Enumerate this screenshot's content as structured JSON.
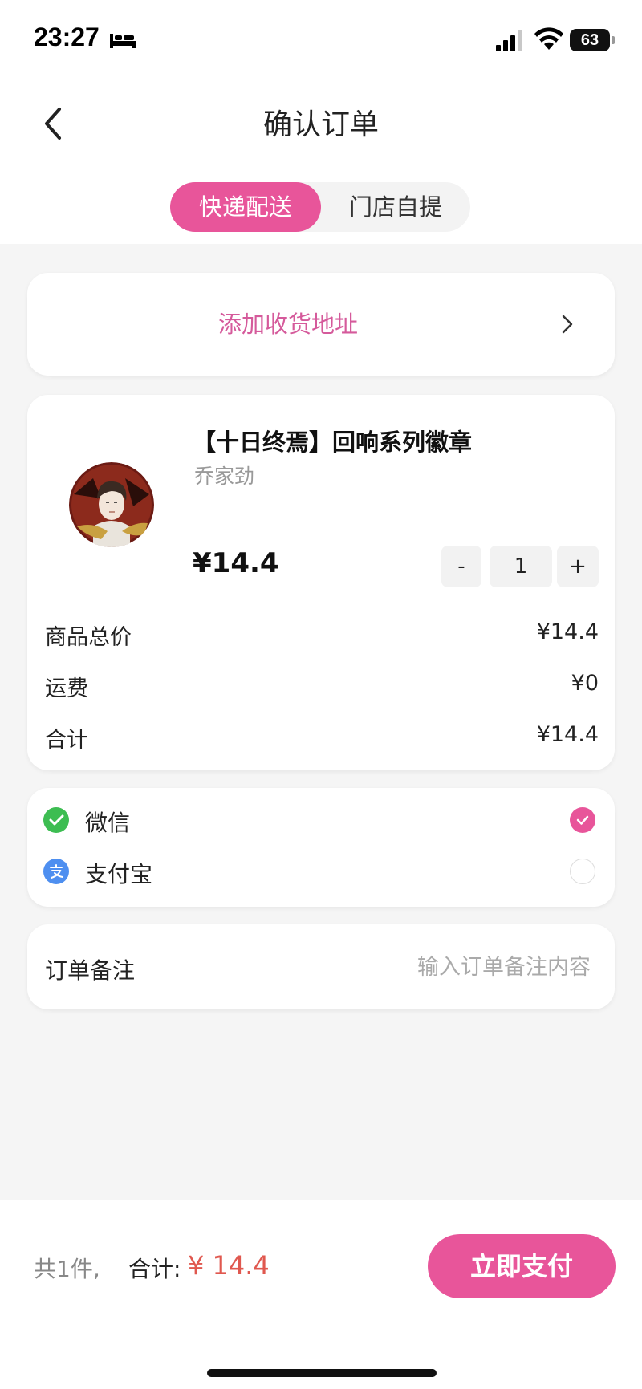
{
  "status_bar": {
    "time": "23:27",
    "battery": "63"
  },
  "nav": {
    "title": "确认订单"
  },
  "delivery_tabs": [
    {
      "label": "快递配送",
      "active": true
    },
    {
      "label": "门店自提",
      "active": false
    }
  ],
  "address": {
    "label": "添加收货地址"
  },
  "product": {
    "title": "【十日终焉】回响系列徽章",
    "subtitle": "乔家劲",
    "price": "¥14.4",
    "quantity": "1",
    "minus": "-",
    "plus": "+"
  },
  "summary": {
    "items_total_label": "商品总价",
    "items_total_value": "¥14.4",
    "shipping_label": "运费",
    "shipping_value": "¥0",
    "total_label": "合计",
    "total_value": "¥14.4"
  },
  "payment": {
    "options": [
      {
        "label": "微信",
        "icon": "wechat-icon",
        "selected": true
      },
      {
        "label": "支付宝",
        "icon": "alipay-icon",
        "selected": false
      }
    ]
  },
  "remark": {
    "label": "订单备注",
    "placeholder": "输入订单备注内容",
    "value": ""
  },
  "bottom": {
    "count": "共1件,",
    "total_label": "合计:",
    "total_value": "¥ 14.4",
    "pay_button": "立即支付"
  },
  "colors": {
    "accent": "#e8559a",
    "price_red": "#e0584f",
    "wechat_green": "#3dbd52",
    "alipay_blue": "#4e8ff0"
  }
}
